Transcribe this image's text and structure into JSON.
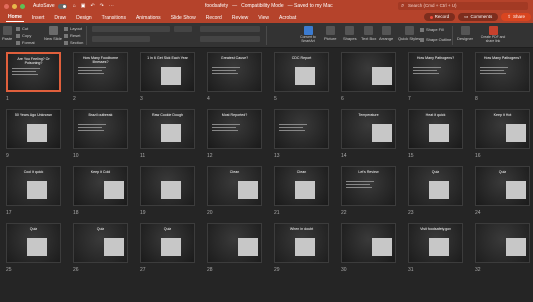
{
  "titlebar": {
    "autosave_label": "AutoSave",
    "doc_name": "foodsafety",
    "separator": "—",
    "mode": "Compatibility Mode",
    "saved": "— Saved to my Mac",
    "search_placeholder": "Search (Cmd + Ctrl + U)"
  },
  "tabs": [
    "Home",
    "Insert",
    "Draw",
    "Design",
    "Transitions",
    "Animations",
    "Slide Show",
    "Record",
    "Review",
    "View",
    "Acrobat"
  ],
  "tab_actions": {
    "record": "Record",
    "comments": "Comments",
    "share": "Share"
  },
  "ribbon": {
    "paste": "Paste",
    "cut": "Cut",
    "copy": "Copy",
    "format": "Format",
    "new_slide": "New Slide",
    "layout": "Layout",
    "reset": "Reset",
    "section": "Section",
    "convert_smartart": "Convert to SmartArt",
    "picture": "Picture",
    "shapes": "Shapes",
    "text_box": "Text Box",
    "arrange": "Arrange",
    "quick_styles": "Quick Styles",
    "shape_fill": "Shape Fill",
    "shape_outline": "Shape Outline",
    "designer": "Designer",
    "create_pdf": "Create PDF and share link"
  },
  "colors": {
    "accent": "#b5432b",
    "selected_border": "#e05f3c"
  },
  "slides": [
    {
      "n": "1",
      "title": "Are You Feeling? Or Poisoning?"
    },
    {
      "n": "2",
      "title": "How Many Foodborne Illnesses?"
    },
    {
      "n": "3",
      "title": "1 in 6 Get Sick Each Year"
    },
    {
      "n": "4",
      "title": "Greatest Cause?"
    },
    {
      "n": "5",
      "title": "CDC Report"
    },
    {
      "n": "6",
      "title": ""
    },
    {
      "n": "7",
      "title": "How Many Pathogens?"
    },
    {
      "n": "8",
      "title": "How Many Pathogens?"
    },
    {
      "n": "9",
      "title": "50 Years Ago Unknown"
    },
    {
      "n": "10",
      "title": "Brazil outbreak"
    },
    {
      "n": "11",
      "title": "Raw Cookie Dough"
    },
    {
      "n": "12",
      "title": "Most Reported?"
    },
    {
      "n": "13",
      "title": ""
    },
    {
      "n": "14",
      "title": "Temperature"
    },
    {
      "n": "15",
      "title": "Heat it quick"
    },
    {
      "n": "16",
      "title": "Keep it Hot"
    },
    {
      "n": "17",
      "title": "Cool it quick"
    },
    {
      "n": "18",
      "title": "Keep it Cold"
    },
    {
      "n": "19",
      "title": ""
    },
    {
      "n": "20",
      "title": "Clean"
    },
    {
      "n": "21",
      "title": "Clean"
    },
    {
      "n": "22",
      "title": "Let's Review"
    },
    {
      "n": "23",
      "title": "Quiz"
    },
    {
      "n": "24",
      "title": "Quiz"
    },
    {
      "n": "25",
      "title": "Quiz"
    },
    {
      "n": "26",
      "title": "Quiz"
    },
    {
      "n": "27",
      "title": "Quiz"
    },
    {
      "n": "28",
      "title": ""
    },
    {
      "n": "29",
      "title": "When in doubt"
    },
    {
      "n": "30",
      "title": ""
    },
    {
      "n": "31",
      "title": "Visit foodsafety.gov"
    },
    {
      "n": "32",
      "title": ""
    }
  ]
}
